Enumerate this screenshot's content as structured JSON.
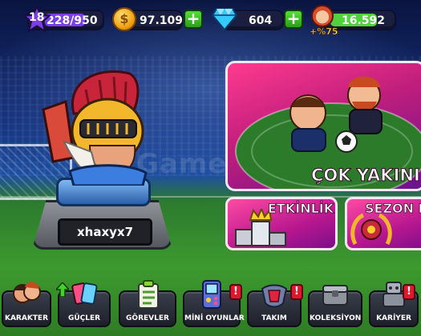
{
  "topbar": {
    "level": "18",
    "xp": "228/950",
    "coins": "97.109",
    "gems": "604",
    "fans": "16.592",
    "fan_bonus": "+%75"
  },
  "player": {
    "name": "xhaxyx7"
  },
  "watermark": "GameSale",
  "feature": {
    "label": "ÇOK YAKINI"
  },
  "tiles": {
    "event": "ETKİNLİK",
    "season": "SEZON B"
  },
  "nav": {
    "characters": "KARAKTER",
    "powers": "GÜÇLER",
    "tasks": "GÖREVLER",
    "minigames": "MİNİ OYUNLAR",
    "team": "TAKIM",
    "collection": "KOLEKSİYON",
    "career": "KARİYER"
  },
  "colors": {
    "accent_pink": "#e8267f",
    "plus_green": "#3fc42a",
    "coin_gold": "#f0a313",
    "gem_blue": "#32c6ff",
    "alert_red": "#e0182d"
  },
  "icons": {
    "xp": "purple-star-icon",
    "coins": "gold-coin-icon",
    "gems": "blue-diamond-icon",
    "fans": "fan-avatar-icon"
  }
}
